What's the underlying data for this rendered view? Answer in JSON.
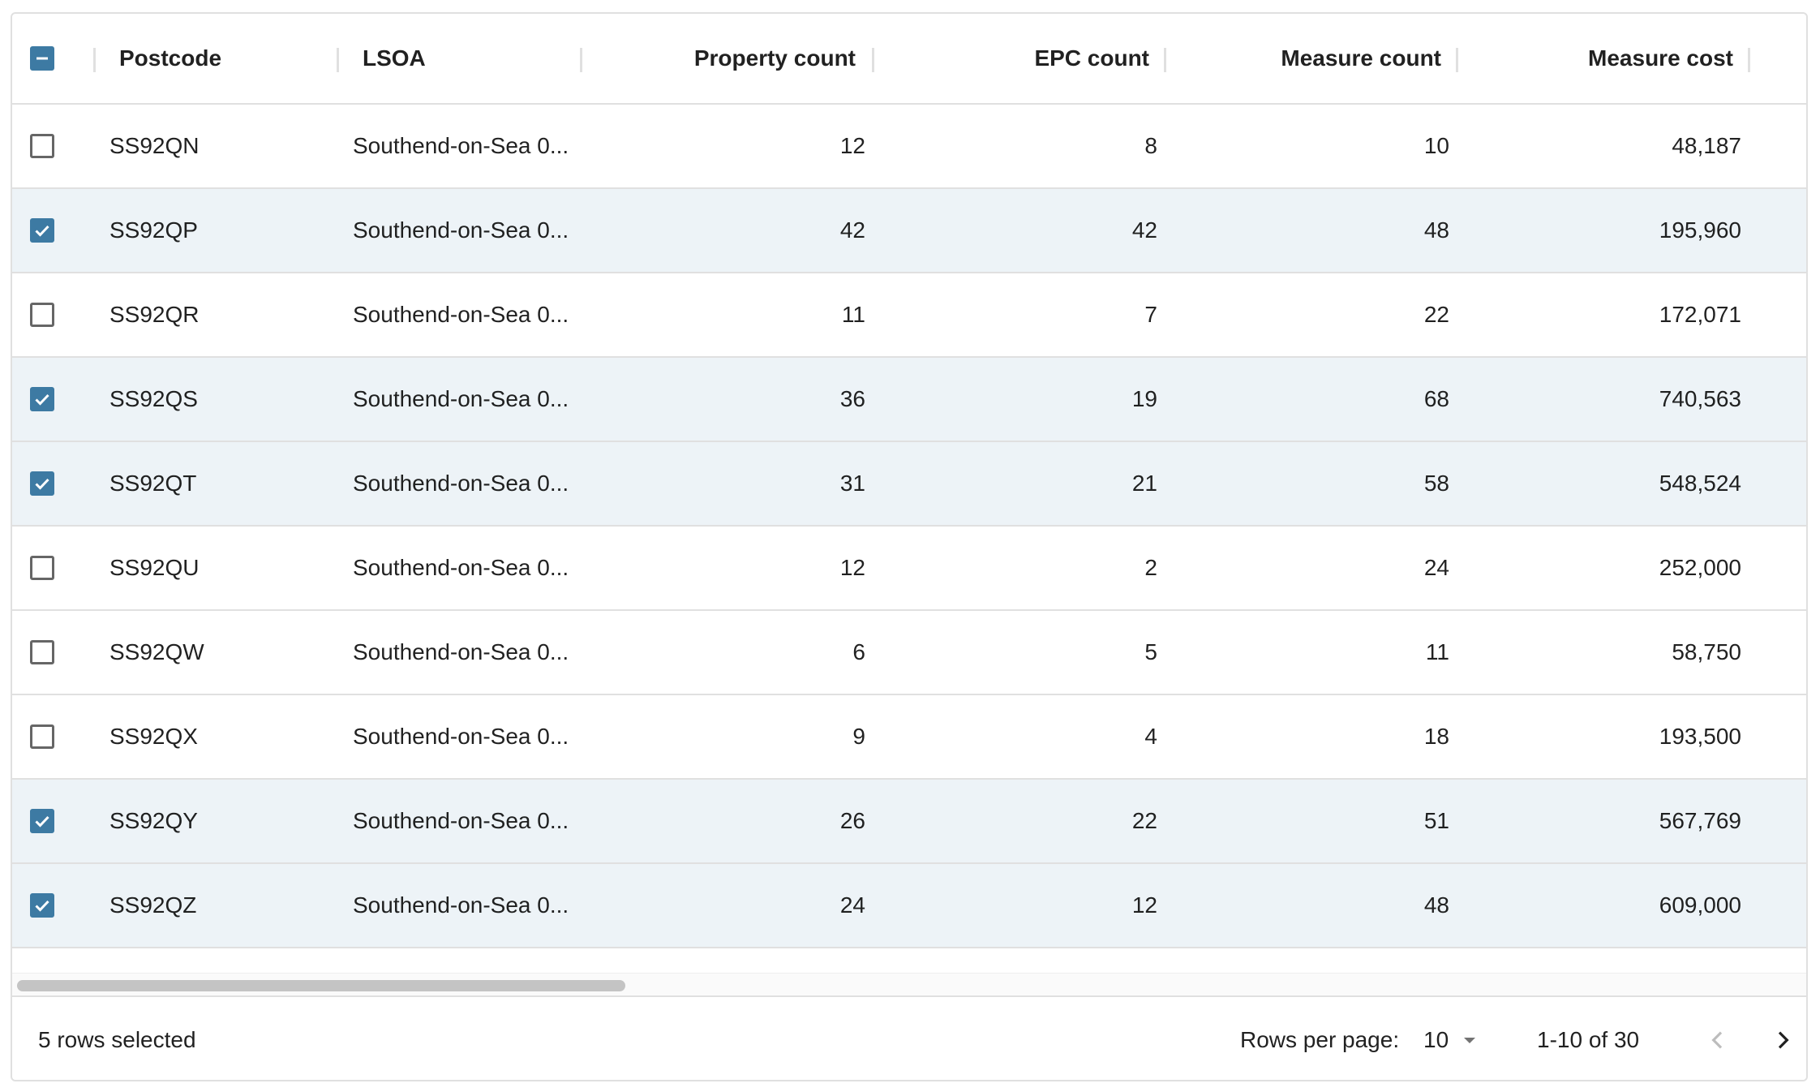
{
  "columns": {
    "postcode": "Postcode",
    "lsoa": "LSOA",
    "property_count": "Property count",
    "epc_count": "EPC count",
    "measure_count": "Measure count",
    "measure_cost": "Measure cost"
  },
  "header_checkbox_state": "indeterminate",
  "rows": [
    {
      "selected": false,
      "postcode": "SS92QN",
      "lsoa": "Southend-on-Sea 0...",
      "property_count": "12",
      "epc_count": "8",
      "measure_count": "10",
      "measure_cost": "48,187"
    },
    {
      "selected": true,
      "postcode": "SS92QP",
      "lsoa": "Southend-on-Sea 0...",
      "property_count": "42",
      "epc_count": "42",
      "measure_count": "48",
      "measure_cost": "195,960"
    },
    {
      "selected": false,
      "postcode": "SS92QR",
      "lsoa": "Southend-on-Sea 0...",
      "property_count": "11",
      "epc_count": "7",
      "measure_count": "22",
      "measure_cost": "172,071"
    },
    {
      "selected": true,
      "postcode": "SS92QS",
      "lsoa": "Southend-on-Sea 0...",
      "property_count": "36",
      "epc_count": "19",
      "measure_count": "68",
      "measure_cost": "740,563"
    },
    {
      "selected": true,
      "postcode": "SS92QT",
      "lsoa": "Southend-on-Sea 0...",
      "property_count": "31",
      "epc_count": "21",
      "measure_count": "58",
      "measure_cost": "548,524"
    },
    {
      "selected": false,
      "postcode": "SS92QU",
      "lsoa": "Southend-on-Sea 0...",
      "property_count": "12",
      "epc_count": "2",
      "measure_count": "24",
      "measure_cost": "252,000"
    },
    {
      "selected": false,
      "postcode": "SS92QW",
      "lsoa": "Southend-on-Sea 0...",
      "property_count": "6",
      "epc_count": "5",
      "measure_count": "11",
      "measure_cost": "58,750"
    },
    {
      "selected": false,
      "postcode": "SS92QX",
      "lsoa": "Southend-on-Sea 0...",
      "property_count": "9",
      "epc_count": "4",
      "measure_count": "18",
      "measure_cost": "193,500"
    },
    {
      "selected": true,
      "postcode": "SS92QY",
      "lsoa": "Southend-on-Sea 0...",
      "property_count": "26",
      "epc_count": "22",
      "measure_count": "51",
      "measure_cost": "567,769"
    },
    {
      "selected": true,
      "postcode": "SS92QZ",
      "lsoa": "Southend-on-Sea 0...",
      "property_count": "24",
      "epc_count": "12",
      "measure_count": "48",
      "measure_cost": "609,000"
    }
  ],
  "footer": {
    "selected_text": "5 rows selected",
    "rows_per_page_label": "Rows per page:",
    "rows_per_page_value": "10",
    "range_text": "1-10 of 30"
  },
  "icons": {
    "prev": "chevron-left-icon",
    "next": "chevron-right-icon",
    "dropdown": "arrow-drop-down-icon"
  },
  "colors": {
    "accent": "#3d7aa3",
    "selected_row_bg": "#edf3f7",
    "border": "#e0e0e0"
  }
}
